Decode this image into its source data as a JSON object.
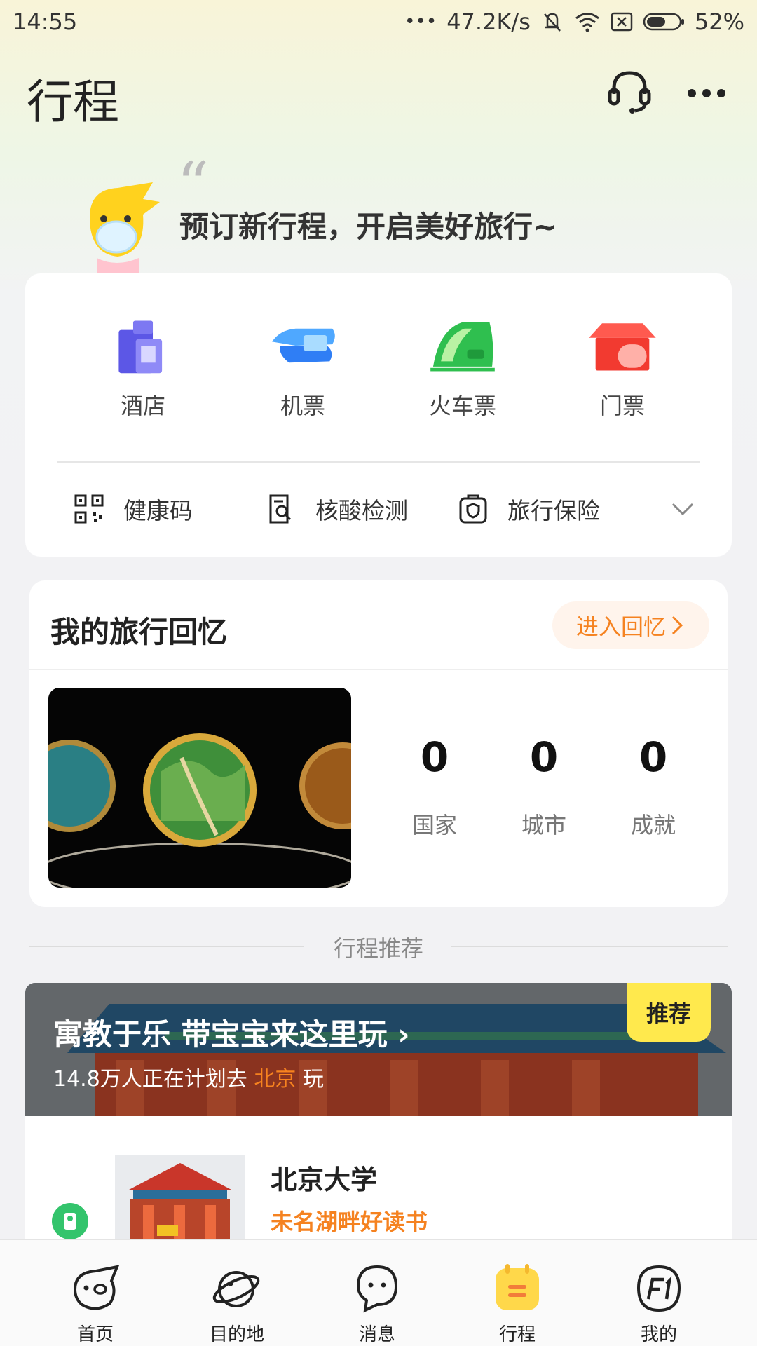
{
  "status_bar": {
    "time": "14:55",
    "dots": "•••",
    "speed": "47.2K/s",
    "battery": "52%",
    "icons": [
      "mute-icon",
      "wifi-icon",
      "no-sim-icon",
      "battery-icon"
    ]
  },
  "header": {
    "title": "行程",
    "icons": [
      "headset-icon",
      "more-icon"
    ]
  },
  "hero": {
    "quote": "“",
    "text": "预订新行程，开启美好旅行~"
  },
  "services": {
    "items": [
      {
        "label": "酒店",
        "icon": "hotel-icon"
      },
      {
        "label": "机票",
        "icon": "flight-icon"
      },
      {
        "label": "火车票",
        "icon": "train-icon"
      },
      {
        "label": "门票",
        "icon": "ticket-icon"
      }
    ],
    "tools": [
      {
        "label": "健康码",
        "icon": "qr-code-icon"
      },
      {
        "label": "核酸检测",
        "icon": "test-report-icon"
      },
      {
        "label": "旅行保险",
        "icon": "insurance-icon"
      }
    ]
  },
  "memories": {
    "title": "我的旅行回忆",
    "enter": "进入回忆",
    "stats": [
      {
        "value": "0",
        "caption": "国家"
      },
      {
        "value": "0",
        "caption": "城市"
      },
      {
        "value": "0",
        "caption": "成就"
      }
    ]
  },
  "recommend": {
    "heading": "行程推荐",
    "banner_title": "寓教于乐 带宝宝来这里玩",
    "banner_sub_prefix": "14.8万人正在计划去 ",
    "banner_city": "北京",
    "banner_sub_suffix": " 玩",
    "badge": "推荐",
    "item_name": "北京大学",
    "item_tag": "未名湖畔好读书"
  },
  "tabbar": {
    "items": [
      {
        "label": "首页",
        "icon": "pig-home-icon"
      },
      {
        "label": "目的地",
        "icon": "planet-icon"
      },
      {
        "label": "消息",
        "icon": "message-icon"
      },
      {
        "label": "行程",
        "icon": "itinerary-icon",
        "active": true
      },
      {
        "label": "我的",
        "icon": "profile-f1-icon"
      }
    ]
  },
  "colors": {
    "accent": "#f58220",
    "badge": "#ffe94d",
    "active_tab": "#ffd84a"
  }
}
